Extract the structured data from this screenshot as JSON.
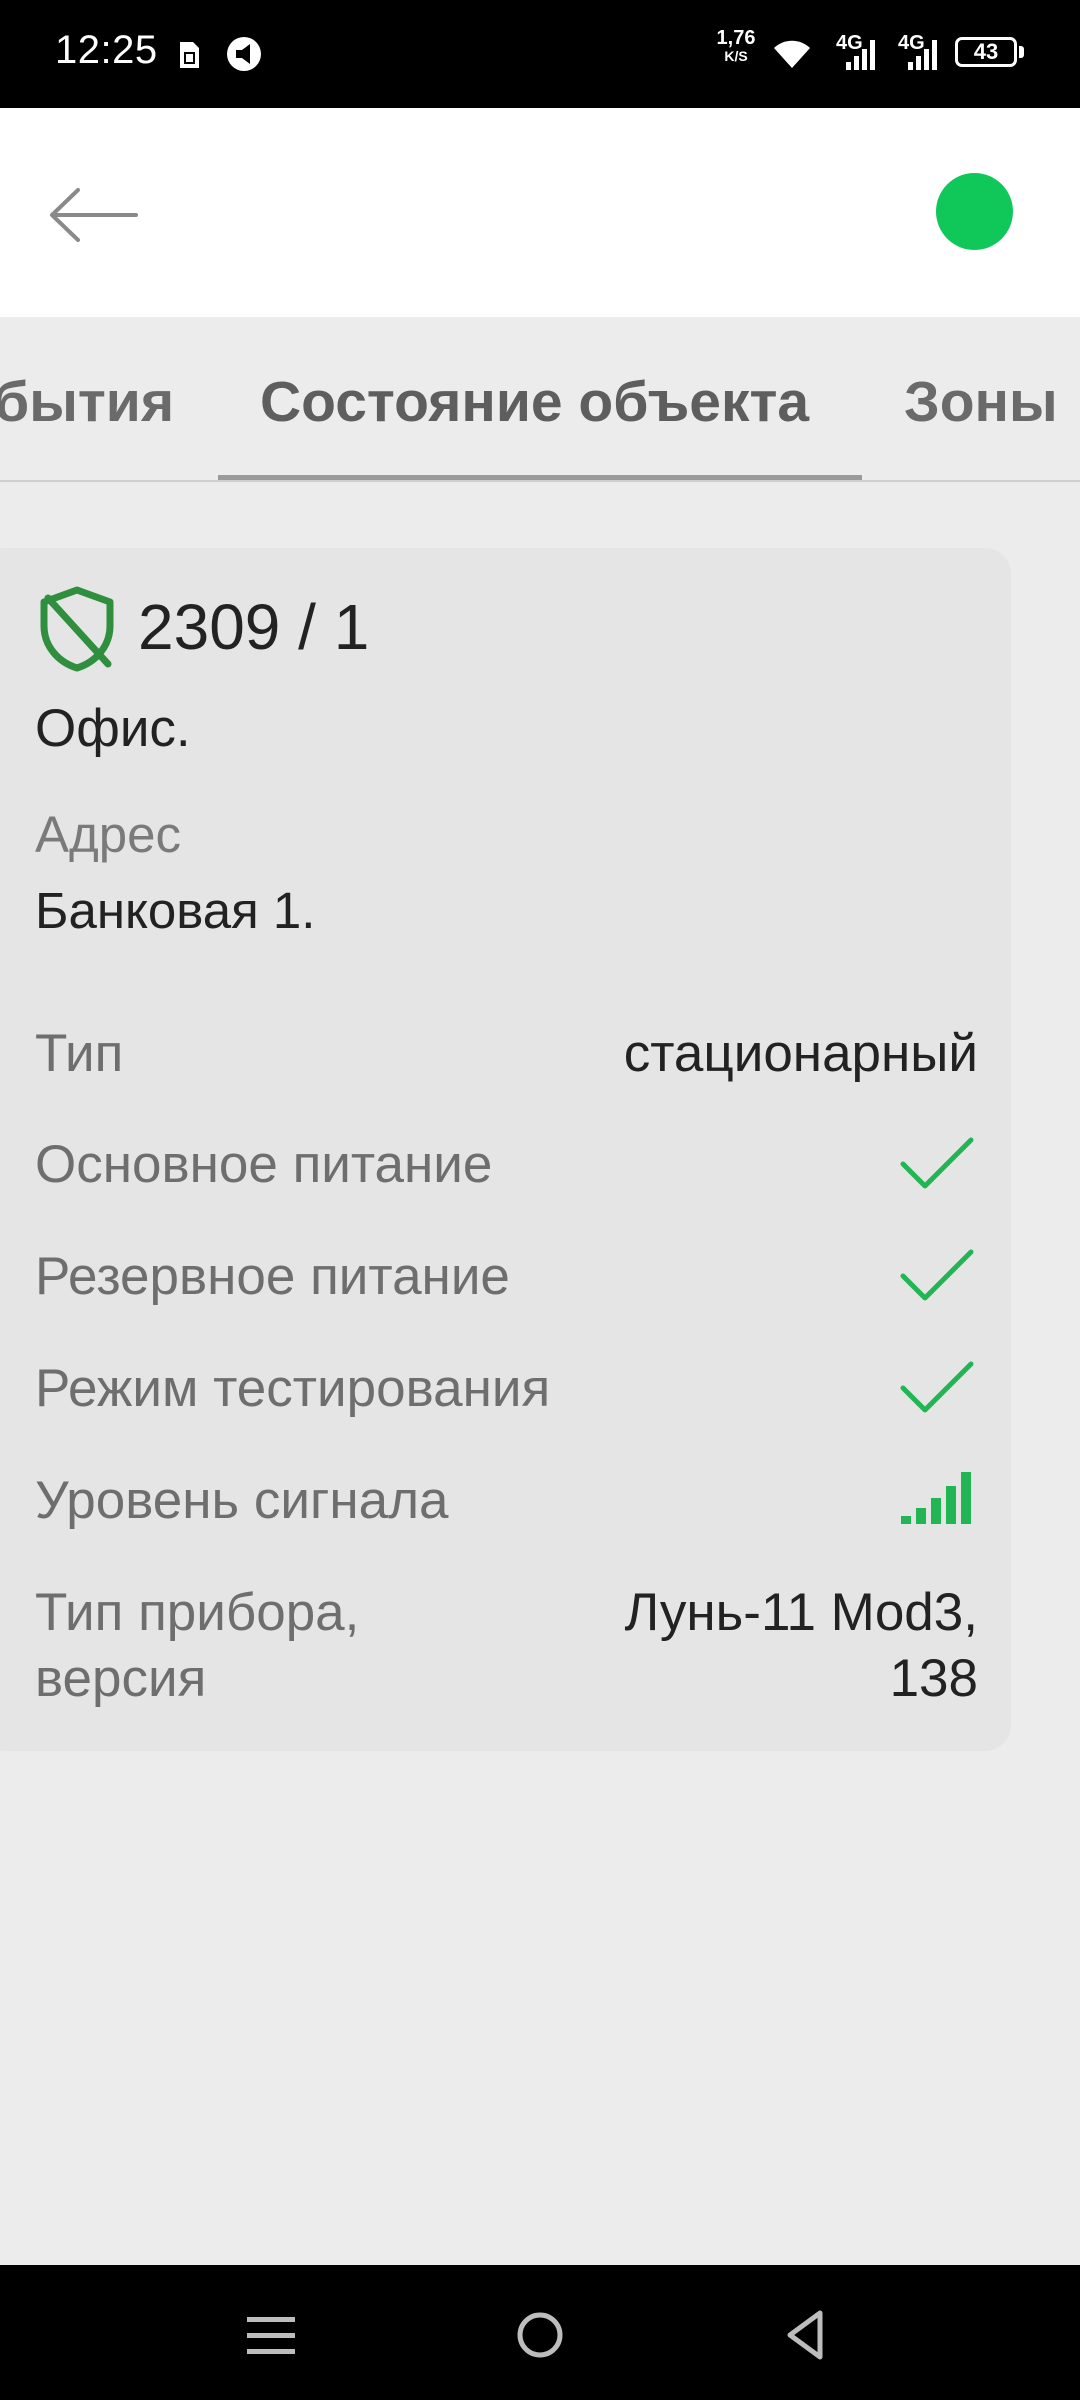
{
  "status_bar": {
    "time": "12:25",
    "speed_value": "1,76",
    "speed_unit": "K/S",
    "network1": "4G",
    "network2": "4G",
    "battery": "43"
  },
  "app_bar": {
    "status_color": "#10c75a"
  },
  "tabs": [
    {
      "label": "бытия"
    },
    {
      "label": "Состояние объекта"
    },
    {
      "label": "Зоны"
    }
  ],
  "card": {
    "object_number": "2309 / 1",
    "object_name": "Офис.",
    "address_label": "Адрес",
    "address_value": "Банковая 1.",
    "rows": {
      "type_label": "Тип",
      "type_value": "стационарный",
      "main_power_label": "Основное питание",
      "backup_power_label": "Резервное питание",
      "test_mode_label": "Режим тестирования",
      "signal_label": "Уровень сигнала",
      "device_label_line1": "Тип прибора,",
      "device_label_line2": "версия",
      "device_value_line1": "Лунь-11 Mod3,",
      "device_value_line2": "138"
    },
    "accent_color": "#22b554"
  }
}
